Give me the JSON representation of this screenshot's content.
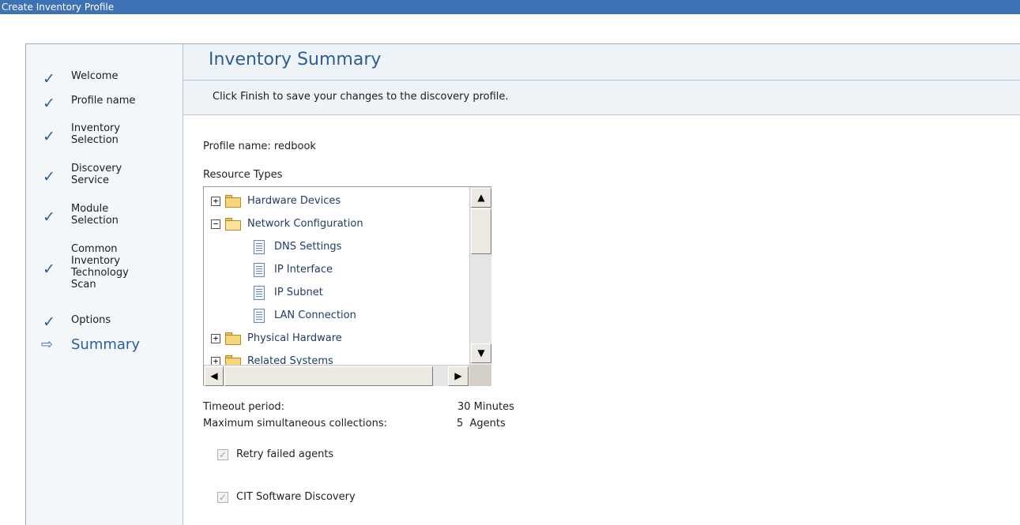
{
  "window": {
    "title": "Create Inventory Profile"
  },
  "sidebar": {
    "steps": [
      {
        "label": "Welcome",
        "status": "done"
      },
      {
        "label": "Profile name",
        "status": "done"
      },
      {
        "label": "Inventory\nSelection",
        "status": "done"
      },
      {
        "label": "Discovery\nService",
        "status": "done"
      },
      {
        "label": "Module\nSelection",
        "status": "done"
      },
      {
        "label": "Common\nInventory\nTechnology\nScan",
        "status": "done"
      },
      {
        "label": "Options",
        "status": "done"
      },
      {
        "label": "Summary",
        "status": "current"
      }
    ],
    "done_icon": "check-icon",
    "current_icon": "arrow-right-icon"
  },
  "header": {
    "title": "Inventory Summary",
    "instruction": "Click Finish to save your changes to the discovery profile."
  },
  "summary": {
    "profile_name_text": "Profile name: redbook",
    "resource_types_label": "Resource Types",
    "timeout_label": "Timeout period:",
    "timeout_value": "30 Minutes",
    "max_collections_label": "Maximum simultaneous collections:",
    "max_collections_value": "5  Agents"
  },
  "tree": {
    "items": [
      {
        "label": "Hardware Devices",
        "type": "folder",
        "expanded": false
      },
      {
        "label": "Network Configuration",
        "type": "folder",
        "expanded": true
      },
      {
        "label": "DNS Settings",
        "type": "leaf"
      },
      {
        "label": "IP Interface",
        "type": "leaf"
      },
      {
        "label": "IP Subnet",
        "type": "leaf"
      },
      {
        "label": "LAN Connection",
        "type": "leaf"
      },
      {
        "label": "Physical Hardware",
        "type": "folder",
        "expanded": false
      },
      {
        "label": "Related Systems",
        "type": "folder",
        "expanded": false
      }
    ]
  },
  "options": {
    "retry_failed_agents": {
      "label": "Retry failed agents",
      "checked": true,
      "disabled": true
    },
    "cit_software_discovery": {
      "label": "CIT Software Discovery",
      "checked": true,
      "disabled": true
    }
  },
  "colors": {
    "titlebar": "#3f72b5",
    "accent": "#2f5c93",
    "header_bg": "#eef3f8",
    "sidebar_bg": "#f4f7fa"
  }
}
